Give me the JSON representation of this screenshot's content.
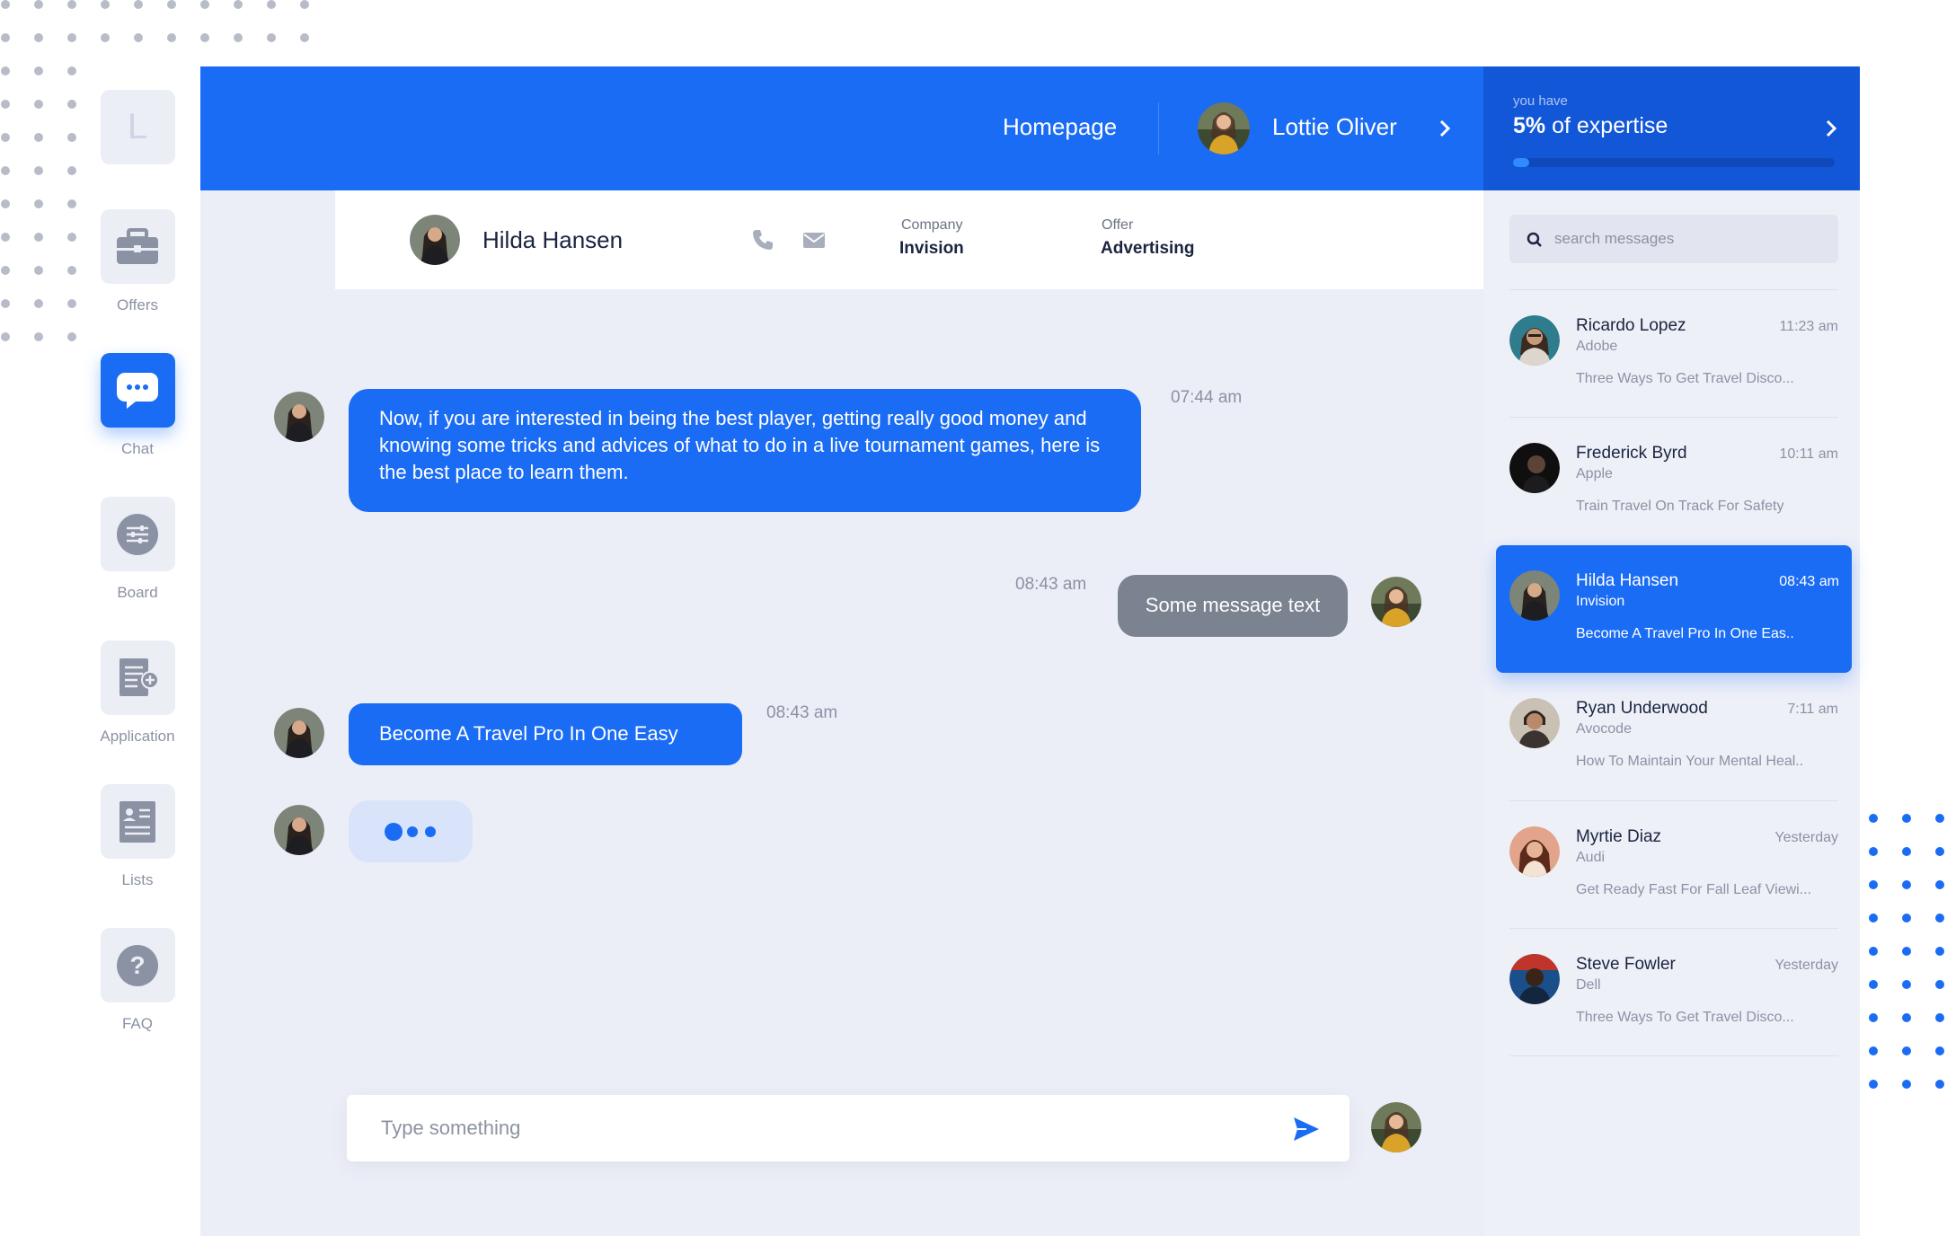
{
  "sidebar": {
    "logo_letter": "L",
    "items": [
      {
        "label": "Offers",
        "icon": "briefcase-icon"
      },
      {
        "label": "Chat",
        "icon": "chat-icon",
        "active": true
      },
      {
        "label": "Board",
        "icon": "sliders-icon"
      },
      {
        "label": "Application",
        "icon": "document-add-icon"
      },
      {
        "label": "Lists",
        "icon": "contact-list-icon"
      },
      {
        "label": "FAQ",
        "icon": "help-icon"
      }
    ]
  },
  "topbar": {
    "home_label": "Homepage",
    "user_name": "Lottie Oliver",
    "expertise_caption": "you have",
    "expertise_value": "5%",
    "expertise_suffix": " of expertise",
    "expertise_progress": 0.05
  },
  "contact": {
    "name": "Hilda Hansen",
    "company_label": "Company",
    "company_value": "Invision",
    "offer_label": "Offer",
    "offer_value": "Advertising"
  },
  "messages": [
    {
      "text": "Now, if you are interested in being the best player, getting really good money and knowing some tricks and advices of what to do in a live tournament games, here is the best place to learn them.",
      "time": "07:44 am"
    },
    {
      "text": "Some message text",
      "time": "08:43 am"
    },
    {
      "text": "Become A Travel Pro In One Easy",
      "time": "08:43 am"
    }
  ],
  "composer": {
    "placeholder": "Type something"
  },
  "search": {
    "placeholder": "search messages"
  },
  "conversations": [
    {
      "name": "Ricardo Lopez",
      "company": "Adobe",
      "time": "11:23 am",
      "preview": "Three Ways To Get Travel Disco..."
    },
    {
      "name": "Frederick Byrd",
      "company": "Apple",
      "time": "10:11 am",
      "preview": "Train Travel On Track For Safety"
    },
    {
      "name": "Hilda Hansen",
      "company": "Invision",
      "time": "08:43 am",
      "preview": "Become A Travel Pro In One Eas.."
    },
    {
      "name": "Ryan Underwood",
      "company": "Avocode",
      "time": "7:11 am",
      "preview": "How To Maintain Your Mental Heal.."
    },
    {
      "name": "Myrtie Diaz",
      "company": "Audi",
      "time": "Yesterday",
      "preview": "Get Ready Fast For Fall Leaf Viewi..."
    },
    {
      "name": "Steve Fowler",
      "company": "Dell",
      "time": "Yesterday",
      "preview": "Three Ways To Get Travel Disco..."
    }
  ],
  "colors": {
    "accent": "#1a6cf5",
    "accent_dark": "#1357d9",
    "background": "#eceef7",
    "muted_text": "#8b92a3"
  }
}
